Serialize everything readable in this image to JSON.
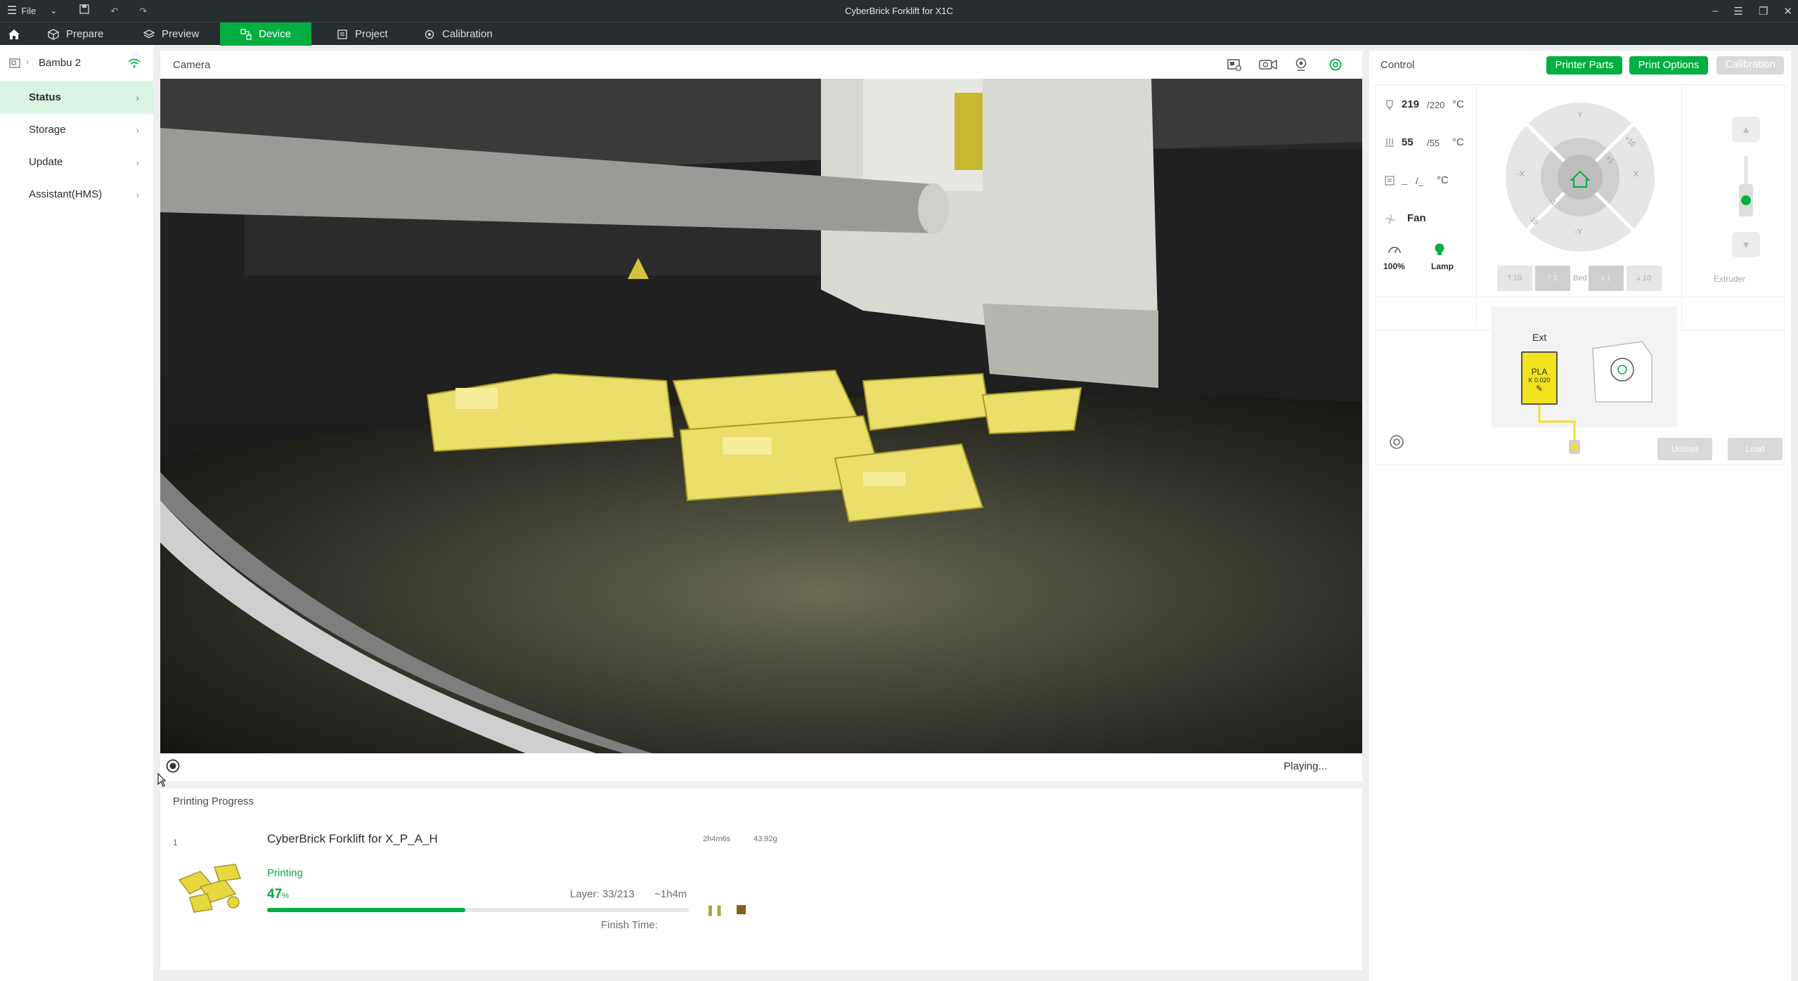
{
  "window": {
    "title": "CyberBrick Forklift for X1C",
    "menu_label": "File"
  },
  "tabs": [
    {
      "label": "Prepare"
    },
    {
      "label": "Preview"
    },
    {
      "label": "Device"
    },
    {
      "label": "Project"
    },
    {
      "label": "Calibration"
    }
  ],
  "sidebar": {
    "printer_name": "Bambu 2",
    "items": [
      {
        "label": "Status"
      },
      {
        "label": "Storage"
      },
      {
        "label": "Update"
      },
      {
        "label": "Assistant(HMS)"
      }
    ]
  },
  "camera": {
    "title": "Camera",
    "status": "Playing..."
  },
  "progress": {
    "title": "Printing Progress",
    "plate_index": "1",
    "job_name": "CyberBrick Forklift for X_P_A_H",
    "time": "2h4m6s",
    "weight": "43.92g",
    "state": "Printing",
    "percent_value": "47",
    "percent_unit": "%",
    "progress_fraction": 0.47,
    "layer": "Layer: 33/213",
    "remaining": "~1h4m",
    "finish_label": "Finish Time:"
  },
  "control": {
    "title": "Control",
    "printer_parts_label": "Printer Parts",
    "print_options_label": "Print Options",
    "calibration_label": "Calibration",
    "nozzle_temp": "219",
    "nozzle_target": "/220",
    "bed_temp": "55",
    "bed_target": "/55",
    "chamber_temp": "_",
    "chamber_target": "/_",
    "temp_unit": "°C",
    "fan_label": "Fan",
    "speed_label": "100%",
    "lamp_label": "Lamp",
    "jog": {
      "y_plus": "Y",
      "y_minus": "-Y",
      "x_plus": "X",
      "x_minus": "-X",
      "plus10": "+10",
      "minus10": "-10",
      "plus1": "+1",
      "minus1": "-1"
    },
    "bed_buttons": [
      "10",
      "1",
      "Bed",
      "1",
      "10"
    ],
    "extruder_label": "Extruder",
    "ext_label": "Ext",
    "filament_type": "PLA",
    "filament_k": "K 0.020",
    "unload_label": "Unload",
    "load_label": "Load",
    "colors": {
      "accent": "#00ae42",
      "filament": "#f2e31c"
    }
  }
}
